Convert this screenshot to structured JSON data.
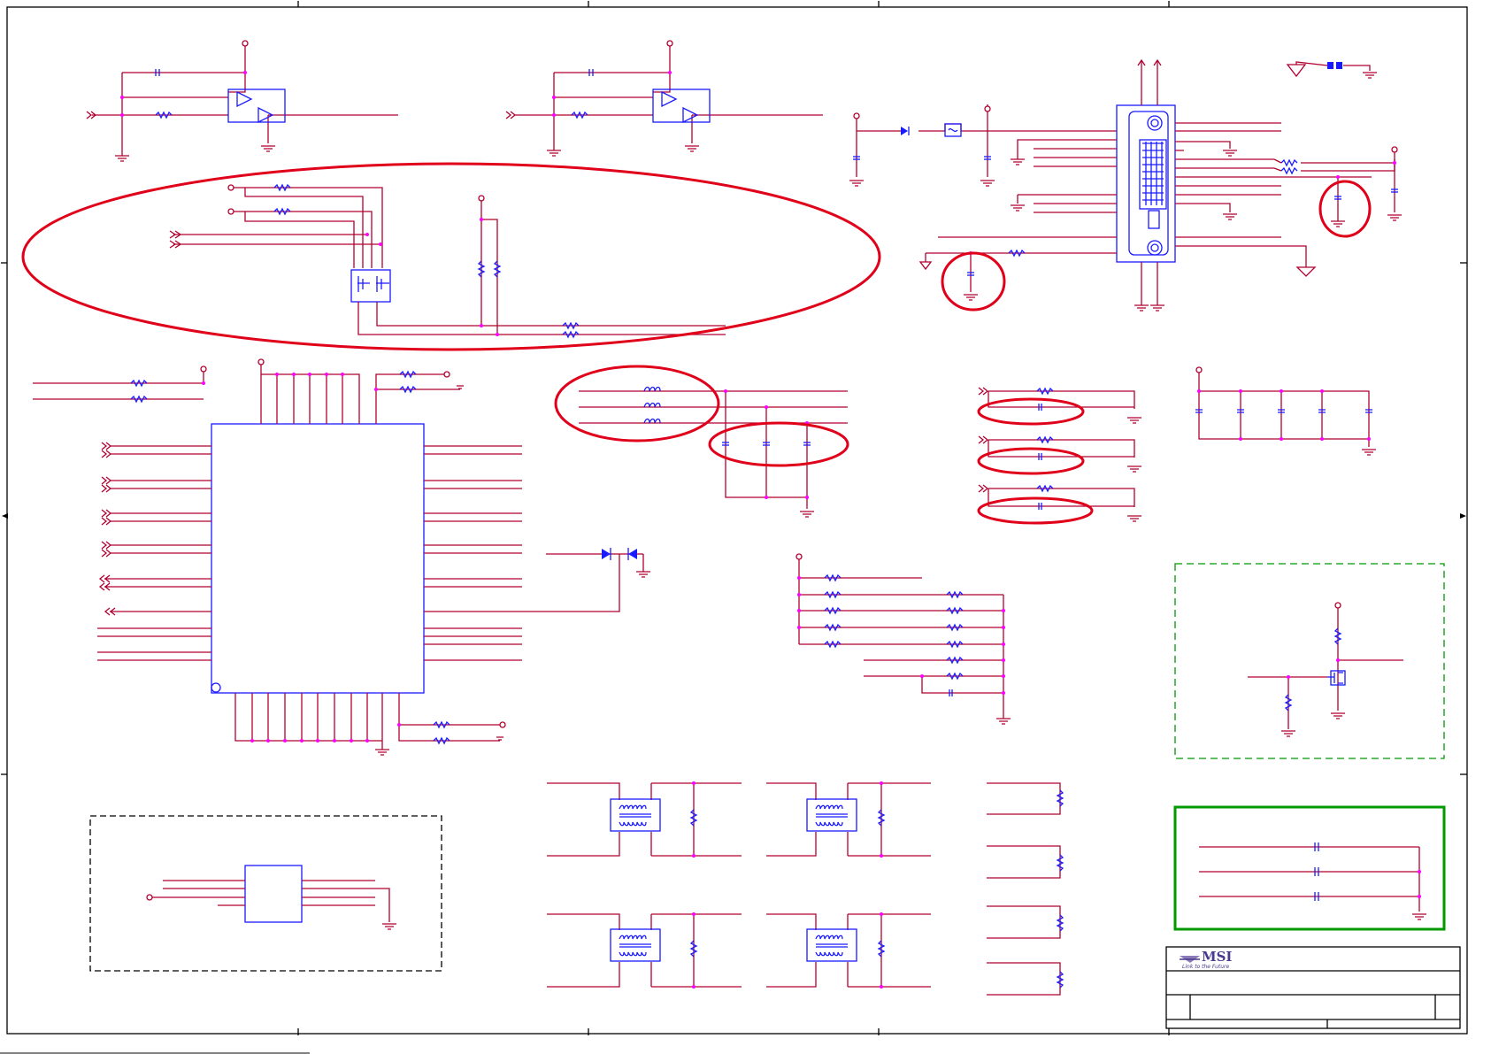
{
  "logo": {
    "brand": "MSI",
    "tagline": "Link to the Future"
  },
  "colors": {
    "wire": "#b00030",
    "component": "#1a1aff",
    "junction": "#ff00ff",
    "highlight": "#e0001a",
    "frame": "#000000",
    "dashed_box_green": "#009900",
    "solid_box_green": "#009900"
  }
}
